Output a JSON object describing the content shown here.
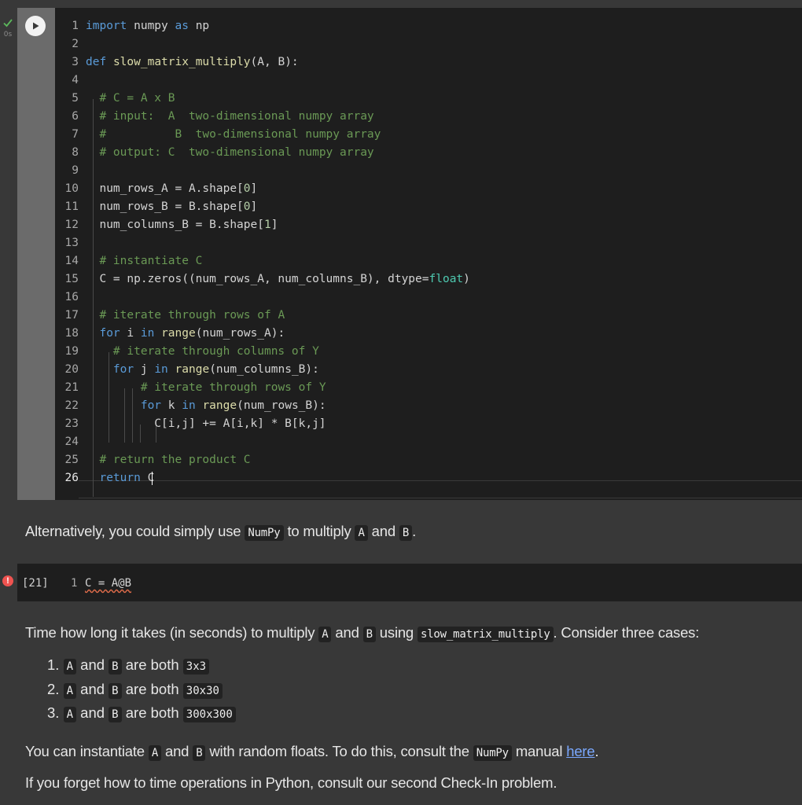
{
  "cell1": {
    "exec_time": "0s",
    "code_lines": [
      {
        "n": "1",
        "html": "<span class='kw'>import</span> numpy <span class='kw'>as</span> np"
      },
      {
        "n": "2",
        "html": ""
      },
      {
        "n": "3",
        "html": "<span class='kw'>def</span> <span class='fn'>slow_matrix_multiply</span>(A, B):"
      },
      {
        "n": "4",
        "html": ""
      },
      {
        "n": "5",
        "html": "  <span class='cm'># C = A x B</span>"
      },
      {
        "n": "6",
        "html": "  <span class='cm'># input:  A  two-dimensional numpy array</span>"
      },
      {
        "n": "7",
        "html": "  <span class='cm'>#          B  two-dimensional numpy array</span>"
      },
      {
        "n": "8",
        "html": "  <span class='cm'># output: C  two-dimensional numpy array</span>"
      },
      {
        "n": "9",
        "html": ""
      },
      {
        "n": "10",
        "html": "  num_rows_A = A.shape[<span class='nm'>0</span>]"
      },
      {
        "n": "11",
        "html": "  num_rows_B = B.shape[<span class='nm'>0</span>]"
      },
      {
        "n": "12",
        "html": "  num_columns_B = B.shape[<span class='nm'>1</span>]"
      },
      {
        "n": "13",
        "html": ""
      },
      {
        "n": "14",
        "html": "  <span class='cm'># instantiate C</span>"
      },
      {
        "n": "15",
        "html": "  C = np.zeros((num_rows_A, num_columns_B), dtype=<span class='bi'>float</span>)"
      },
      {
        "n": "16",
        "html": ""
      },
      {
        "n": "17",
        "html": "  <span class='cm'># iterate through rows of A</span>"
      },
      {
        "n": "18",
        "html": "  <span class='kw'>for</span> i <span class='kw'>in</span> <span class='fn'>range</span>(num_rows_A):"
      },
      {
        "n": "19",
        "html": "    <span class='cm'># iterate through columns of Y</span>"
      },
      {
        "n": "20",
        "html": "    <span class='kw'>for</span> j <span class='kw'>in</span> <span class='fn'>range</span>(num_columns_B):"
      },
      {
        "n": "21",
        "html": "        <span class='cm'># iterate through rows of Y</span>"
      },
      {
        "n": "22",
        "html": "        <span class='kw'>for</span> k <span class='kw'>in</span> <span class='fn'>range</span>(num_rows_B):"
      },
      {
        "n": "23",
        "html": "          C[i,j] += A[i,k] * B[k,j]"
      },
      {
        "n": "24",
        "html": ""
      },
      {
        "n": "25",
        "html": "  <span class='cm'># return the product C</span>"
      },
      {
        "n": "26",
        "html": "  <span class='kw'>return</span> C<span class='cursor'></span>"
      }
    ]
  },
  "md1": {
    "prefix": "Alternatively, you could simply use ",
    "code1": "NumPy",
    "mid": " to multiply ",
    "code2": "A",
    "and": " and ",
    "code3": "B",
    "suffix": "."
  },
  "cell2": {
    "exec_count": "[21]",
    "line_number": "1",
    "code": "C = A@B"
  },
  "md2": {
    "p1_prefix": "Time how long it takes (in seconds) to multiply ",
    "p1_a": "A",
    "p1_and": " and ",
    "p1_b": "B",
    "p1_using": " using ",
    "p1_fn": "slow_matrix_multiply",
    "p1_suffix": ". Consider three cases:",
    "cases": [
      {
        "num": "1. ",
        "a": "A",
        "and": " and ",
        "b": "B",
        "are": " are both ",
        "size": "3x3"
      },
      {
        "num": "2. ",
        "a": "A",
        "and": " and ",
        "b": "B",
        "are": " are both ",
        "size": "30x30"
      },
      {
        "num": "3. ",
        "a": "A",
        "and": " and ",
        "b": "B",
        "are": " are both ",
        "size": "300x300"
      }
    ],
    "p2_prefix": "You can instantiate ",
    "p2_a": "A",
    "p2_and": " and ",
    "p2_b": "B",
    "p2_mid": " with random floats. To do this, consult the ",
    "p2_numpy": "NumPy",
    "p2_manual": " manual ",
    "p2_link": "here",
    "p2_suffix": ".",
    "p3": "If you forget how to time operations in Python, consult our second Check-In problem."
  }
}
